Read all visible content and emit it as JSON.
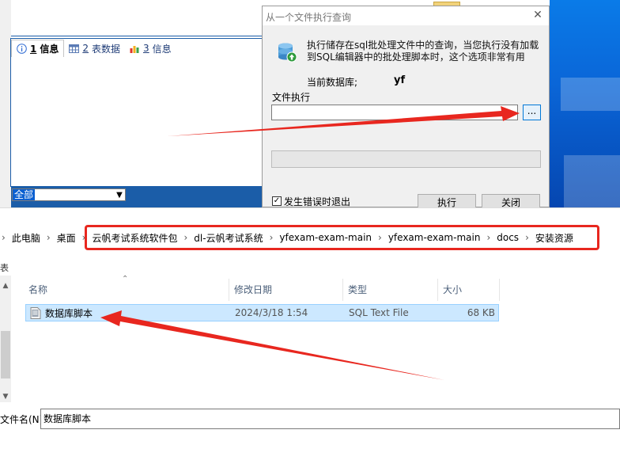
{
  "background_app": {
    "tabs": [
      {
        "num": "1",
        "label": "信息",
        "icon": "info-icon",
        "active": true
      },
      {
        "num": "2",
        "label": "表数据",
        "icon": "table-grid-icon",
        "active": false
      },
      {
        "num": "3",
        "label": "信息",
        "icon": "chart-bars-icon",
        "active": false
      }
    ],
    "filter_value": "全部"
  },
  "dialog": {
    "title": "从一个文件执行查询",
    "description": "执行储存在sql批处理文件中的查询，当您执行没有加载到SQL编辑器中的批处理脚本时，这个选项非常有用",
    "current_db_label": "当前数据库;",
    "current_db_value": "yf",
    "file_exec_label": "文件执行",
    "file_path_value": "",
    "browse_label": "...",
    "checkbox_label": "发生错误时退出",
    "checkbox_checked": true,
    "execute_button": "执行",
    "close_button": "关闭"
  },
  "explorer": {
    "breadcrumb": [
      "此电脑",
      "桌面",
      "云帆考试系统软件包",
      "dl-云帆考试系统",
      "yfexam-exam-main",
      "yfexam-exam-main",
      "docs",
      "安装资源"
    ],
    "columns": {
      "name": "名称",
      "date": "修改日期",
      "type": "类型",
      "size": "大小"
    },
    "files": [
      {
        "name": "数据库脚本",
        "date": "2024/3/18 1:54",
        "type": "SQL Text File",
        "size": "68 KB",
        "selected": true
      }
    ],
    "filename_label": "文件名(N):",
    "filename_value": "数据库脚本",
    "nav_fragment": "表"
  },
  "colors": {
    "annotation_red": "#e8271f",
    "selection": "#cce8ff",
    "accent_blue": "#1b5da8"
  }
}
